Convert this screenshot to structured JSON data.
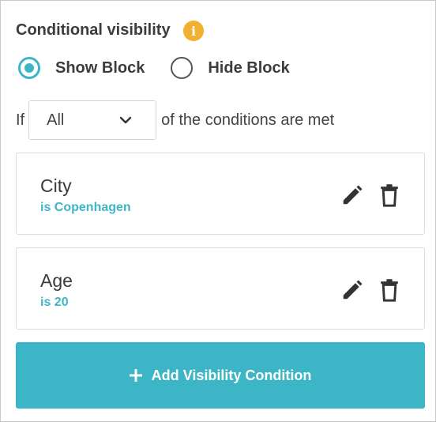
{
  "header": {
    "title": "Conditional visibility",
    "info_glyph": "i"
  },
  "visibility": {
    "options": [
      {
        "label": "Show Block",
        "selected": true
      },
      {
        "label": "Hide Block",
        "selected": false
      }
    ]
  },
  "rule": {
    "prefix": "If",
    "selected": "All",
    "suffix": "of the conditions are met"
  },
  "conditions": [
    {
      "field": "City",
      "condition": "is Copenhagen"
    },
    {
      "field": "Age",
      "condition": "is 20"
    }
  ],
  "add_button": {
    "label": "Add Visibility Condition"
  },
  "colors": {
    "accent": "#3cb6c7",
    "info": "#f0b030"
  }
}
